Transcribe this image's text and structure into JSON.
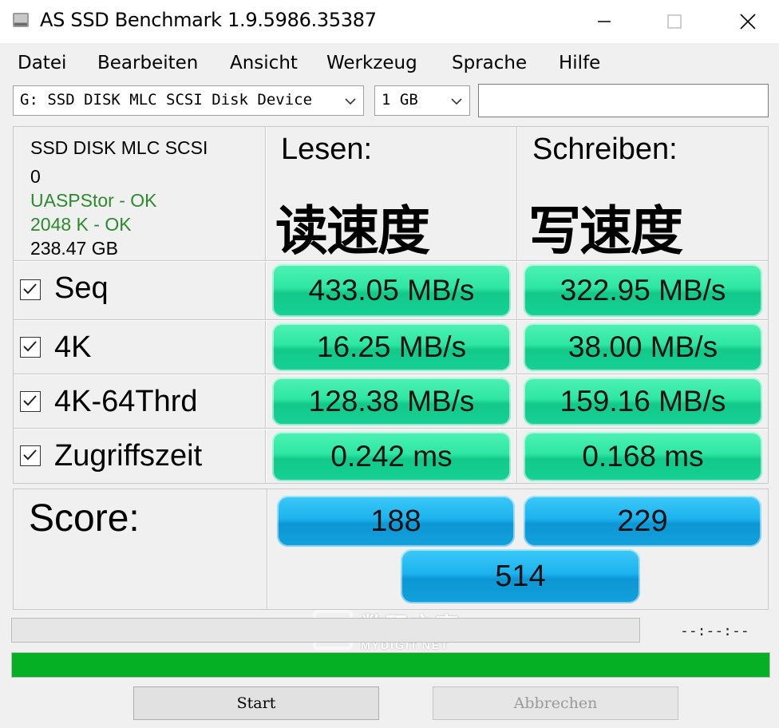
{
  "window": {
    "title": "AS SSD Benchmark 1.9.5986.35387"
  },
  "menu": [
    "Datei",
    "Bearbeiten",
    "Ansicht",
    "Werkzeug",
    "Sprache",
    "Hilfe"
  ],
  "toolbar": {
    "drive_value": "G: SSD DISK  MLC SCSI Disk Device",
    "size_value": "1 GB",
    "text_value": ""
  },
  "drive_info": {
    "name": "SSD DISK  MLC SCSI",
    "index": "0",
    "driver": "UASPStor - OK",
    "alignment": "2048 K - OK",
    "capacity": "238.47 GB"
  },
  "columns": {
    "read": "Lesen:",
    "write": "Schreiben:",
    "read_zh": "读速度",
    "write_zh": "写速度"
  },
  "rows": [
    {
      "label": "Seq",
      "checked": true,
      "read": "433.05 MB/s",
      "write": "322.95 MB/s"
    },
    {
      "label": "4K",
      "checked": true,
      "read": "16.25 MB/s",
      "write": "38.00 MB/s"
    },
    {
      "label": "4K-64Thrd",
      "checked": true,
      "read": "128.38 MB/s",
      "write": "159.16 MB/s"
    },
    {
      "label": "Zugriffszeit",
      "checked": true,
      "read": "0.242 ms",
      "write": "0.168 ms"
    }
  ],
  "score": {
    "label": "Score:",
    "read": "188",
    "write": "229",
    "total": "514"
  },
  "progress": {
    "time_text": "--:--:--",
    "overall_fraction": 1.0
  },
  "buttons": {
    "start": "Start",
    "abort": "Abbrechen"
  },
  "watermark": {
    "text": "数码之家",
    "sub": "MYDIGIT.NET"
  },
  "colors": {
    "result_pill": "#2ee6a3",
    "score_pill": "#1cb3ef",
    "progress_fill": "#06b025",
    "ok_text": "#2c8a2c"
  }
}
